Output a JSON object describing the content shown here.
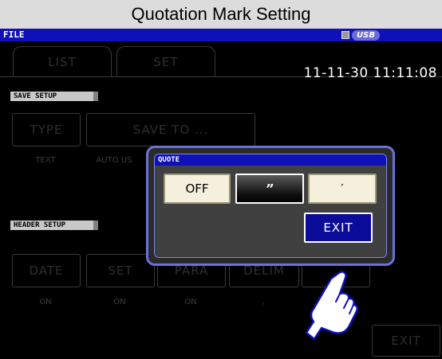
{
  "window": {
    "title": "Quotation Mark Setting"
  },
  "menu_bar": {
    "label": "FILE",
    "usb_label": "USB"
  },
  "tabs": [
    {
      "label": "LIST",
      "active": false
    },
    {
      "label": "SET",
      "active": false
    }
  ],
  "clock": "11-11-30 11:11:08",
  "save_setup": {
    "section_label": "SAVE SETUP",
    "type_button": "TYPE",
    "type_value": "TEXT",
    "save_to_button": "SAVE TO ...",
    "save_to_value": "AUTO US"
  },
  "header_setup": {
    "section_label": "HEADER SETUP",
    "buttons": [
      {
        "label": "DATE",
        "value": "ON"
      },
      {
        "label": "SET",
        "value": "ON"
      },
      {
        "label": "PARA",
        "value": "ON"
      },
      {
        "label": "DELIM",
        "value": ","
      }
    ]
  },
  "background_exit": "EXIT",
  "dialog": {
    "title": "QUOTE",
    "options": [
      "OFF",
      "”",
      "′"
    ],
    "selected": "”",
    "exit_label": "EXIT"
  },
  "colors": {
    "menu_bar": "#1010b8",
    "dialog_border": "#6a72d8",
    "exit_button": "#0b0b9a",
    "option_background": "#f4f0dc"
  },
  "icons": {
    "pointer": "pointing-hand-icon",
    "usb_indicator": "usb-drive-icon"
  }
}
